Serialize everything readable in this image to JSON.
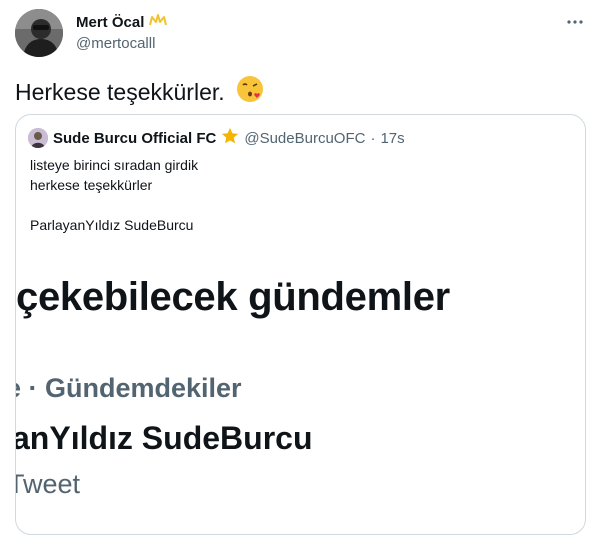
{
  "tweet": {
    "author_name": "Mert Öcal",
    "author_handle": "@mertocalll",
    "badge_icon": "crown-badge-icon",
    "text": "Herkese teşekkürler.",
    "emoji": "😘"
  },
  "quoted_tweet": {
    "author_name": "Sude Burcu Official FC",
    "badge_icon": "star-badge-icon",
    "author_handle": "@SudeBurcuOFC",
    "separator": "·",
    "time": "17s",
    "lines": [
      "listeye birinci sıradan girdik",
      "herkese teşekkürler",
      "",
      "ParlayanYıldız SudeBurcu"
    ],
    "media": {
      "heading": "çekebilecek gündemler",
      "meta": "e · Gündemdekiler",
      "trend": "anYıldız SudeBurcu",
      "count": "Tweet"
    }
  },
  "colors": {
    "text_primary": "#0f1419",
    "text_secondary": "#536471",
    "border": "#cfd9de",
    "star": "#f4b400",
    "crown": "#f2c230"
  }
}
